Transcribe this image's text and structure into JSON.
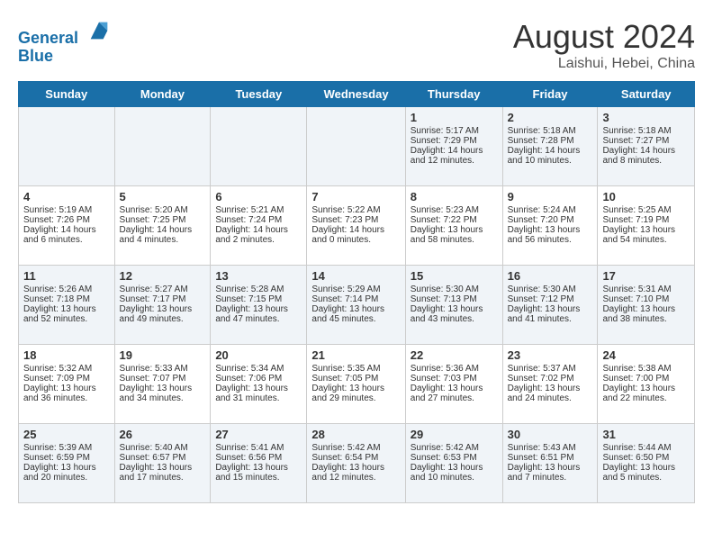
{
  "header": {
    "logo_line1": "General",
    "logo_line2": "Blue",
    "month_year": "August 2024",
    "location": "Laishui, Hebei, China"
  },
  "days_of_week": [
    "Sunday",
    "Monday",
    "Tuesday",
    "Wednesday",
    "Thursday",
    "Friday",
    "Saturday"
  ],
  "weeks": [
    [
      {
        "day": "",
        "content": ""
      },
      {
        "day": "",
        "content": ""
      },
      {
        "day": "",
        "content": ""
      },
      {
        "day": "",
        "content": ""
      },
      {
        "day": "1",
        "content": "Sunrise: 5:17 AM\nSunset: 7:29 PM\nDaylight: 14 hours\nand 12 minutes."
      },
      {
        "day": "2",
        "content": "Sunrise: 5:18 AM\nSunset: 7:28 PM\nDaylight: 14 hours\nand 10 minutes."
      },
      {
        "day": "3",
        "content": "Sunrise: 5:18 AM\nSunset: 7:27 PM\nDaylight: 14 hours\nand 8 minutes."
      }
    ],
    [
      {
        "day": "4",
        "content": "Sunrise: 5:19 AM\nSunset: 7:26 PM\nDaylight: 14 hours\nand 6 minutes."
      },
      {
        "day": "5",
        "content": "Sunrise: 5:20 AM\nSunset: 7:25 PM\nDaylight: 14 hours\nand 4 minutes."
      },
      {
        "day": "6",
        "content": "Sunrise: 5:21 AM\nSunset: 7:24 PM\nDaylight: 14 hours\nand 2 minutes."
      },
      {
        "day": "7",
        "content": "Sunrise: 5:22 AM\nSunset: 7:23 PM\nDaylight: 14 hours\nand 0 minutes."
      },
      {
        "day": "8",
        "content": "Sunrise: 5:23 AM\nSunset: 7:22 PM\nDaylight: 13 hours\nand 58 minutes."
      },
      {
        "day": "9",
        "content": "Sunrise: 5:24 AM\nSunset: 7:20 PM\nDaylight: 13 hours\nand 56 minutes."
      },
      {
        "day": "10",
        "content": "Sunrise: 5:25 AM\nSunset: 7:19 PM\nDaylight: 13 hours\nand 54 minutes."
      }
    ],
    [
      {
        "day": "11",
        "content": "Sunrise: 5:26 AM\nSunset: 7:18 PM\nDaylight: 13 hours\nand 52 minutes."
      },
      {
        "day": "12",
        "content": "Sunrise: 5:27 AM\nSunset: 7:17 PM\nDaylight: 13 hours\nand 49 minutes."
      },
      {
        "day": "13",
        "content": "Sunrise: 5:28 AM\nSunset: 7:15 PM\nDaylight: 13 hours\nand 47 minutes."
      },
      {
        "day": "14",
        "content": "Sunrise: 5:29 AM\nSunset: 7:14 PM\nDaylight: 13 hours\nand 45 minutes."
      },
      {
        "day": "15",
        "content": "Sunrise: 5:30 AM\nSunset: 7:13 PM\nDaylight: 13 hours\nand 43 minutes."
      },
      {
        "day": "16",
        "content": "Sunrise: 5:30 AM\nSunset: 7:12 PM\nDaylight: 13 hours\nand 41 minutes."
      },
      {
        "day": "17",
        "content": "Sunrise: 5:31 AM\nSunset: 7:10 PM\nDaylight: 13 hours\nand 38 minutes."
      }
    ],
    [
      {
        "day": "18",
        "content": "Sunrise: 5:32 AM\nSunset: 7:09 PM\nDaylight: 13 hours\nand 36 minutes."
      },
      {
        "day": "19",
        "content": "Sunrise: 5:33 AM\nSunset: 7:07 PM\nDaylight: 13 hours\nand 34 minutes."
      },
      {
        "day": "20",
        "content": "Sunrise: 5:34 AM\nSunset: 7:06 PM\nDaylight: 13 hours\nand 31 minutes."
      },
      {
        "day": "21",
        "content": "Sunrise: 5:35 AM\nSunset: 7:05 PM\nDaylight: 13 hours\nand 29 minutes."
      },
      {
        "day": "22",
        "content": "Sunrise: 5:36 AM\nSunset: 7:03 PM\nDaylight: 13 hours\nand 27 minutes."
      },
      {
        "day": "23",
        "content": "Sunrise: 5:37 AM\nSunset: 7:02 PM\nDaylight: 13 hours\nand 24 minutes."
      },
      {
        "day": "24",
        "content": "Sunrise: 5:38 AM\nSunset: 7:00 PM\nDaylight: 13 hours\nand 22 minutes."
      }
    ],
    [
      {
        "day": "25",
        "content": "Sunrise: 5:39 AM\nSunset: 6:59 PM\nDaylight: 13 hours\nand 20 minutes."
      },
      {
        "day": "26",
        "content": "Sunrise: 5:40 AM\nSunset: 6:57 PM\nDaylight: 13 hours\nand 17 minutes."
      },
      {
        "day": "27",
        "content": "Sunrise: 5:41 AM\nSunset: 6:56 PM\nDaylight: 13 hours\nand 15 minutes."
      },
      {
        "day": "28",
        "content": "Sunrise: 5:42 AM\nSunset: 6:54 PM\nDaylight: 13 hours\nand 12 minutes."
      },
      {
        "day": "29",
        "content": "Sunrise: 5:42 AM\nSunset: 6:53 PM\nDaylight: 13 hours\nand 10 minutes."
      },
      {
        "day": "30",
        "content": "Sunrise: 5:43 AM\nSunset: 6:51 PM\nDaylight: 13 hours\nand 7 minutes."
      },
      {
        "day": "31",
        "content": "Sunrise: 5:44 AM\nSunset: 6:50 PM\nDaylight: 13 hours\nand 5 minutes."
      }
    ]
  ]
}
